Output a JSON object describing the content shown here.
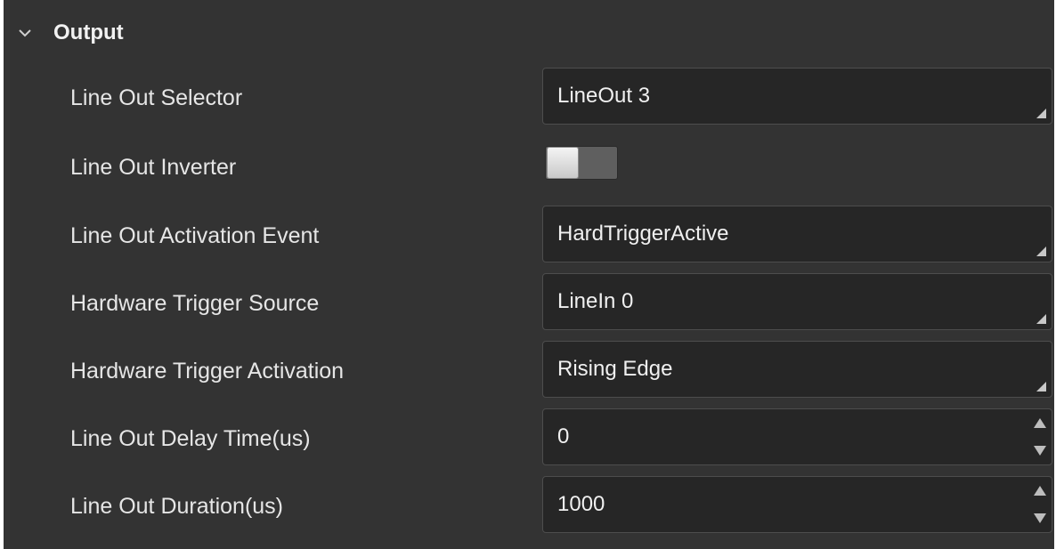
{
  "section": {
    "title": "Output",
    "expanded": true,
    "chevron_icon": "chevron-down-icon"
  },
  "rows": [
    {
      "label": "Line Out Selector",
      "type": "dropdown",
      "value": "LineOut 3"
    },
    {
      "label": "Line Out Inverter",
      "type": "toggle",
      "checked": false
    },
    {
      "label": "Line Out Activation Event",
      "type": "dropdown",
      "value": "HardTriggerActive"
    },
    {
      "label": "Hardware Trigger Source",
      "type": "dropdown",
      "value": "LineIn 0"
    },
    {
      "label": "Hardware Trigger Activation",
      "type": "dropdown",
      "value": "Rising Edge"
    },
    {
      "label": "Line Out Delay Time(us)",
      "type": "spinbox",
      "value": "0"
    },
    {
      "label": "Line Out Duration(us)",
      "type": "spinbox",
      "value": "1000"
    }
  ],
  "colors": {
    "panel_bg": "#333333",
    "field_bg": "#262626",
    "text": "#e6e6e6"
  }
}
